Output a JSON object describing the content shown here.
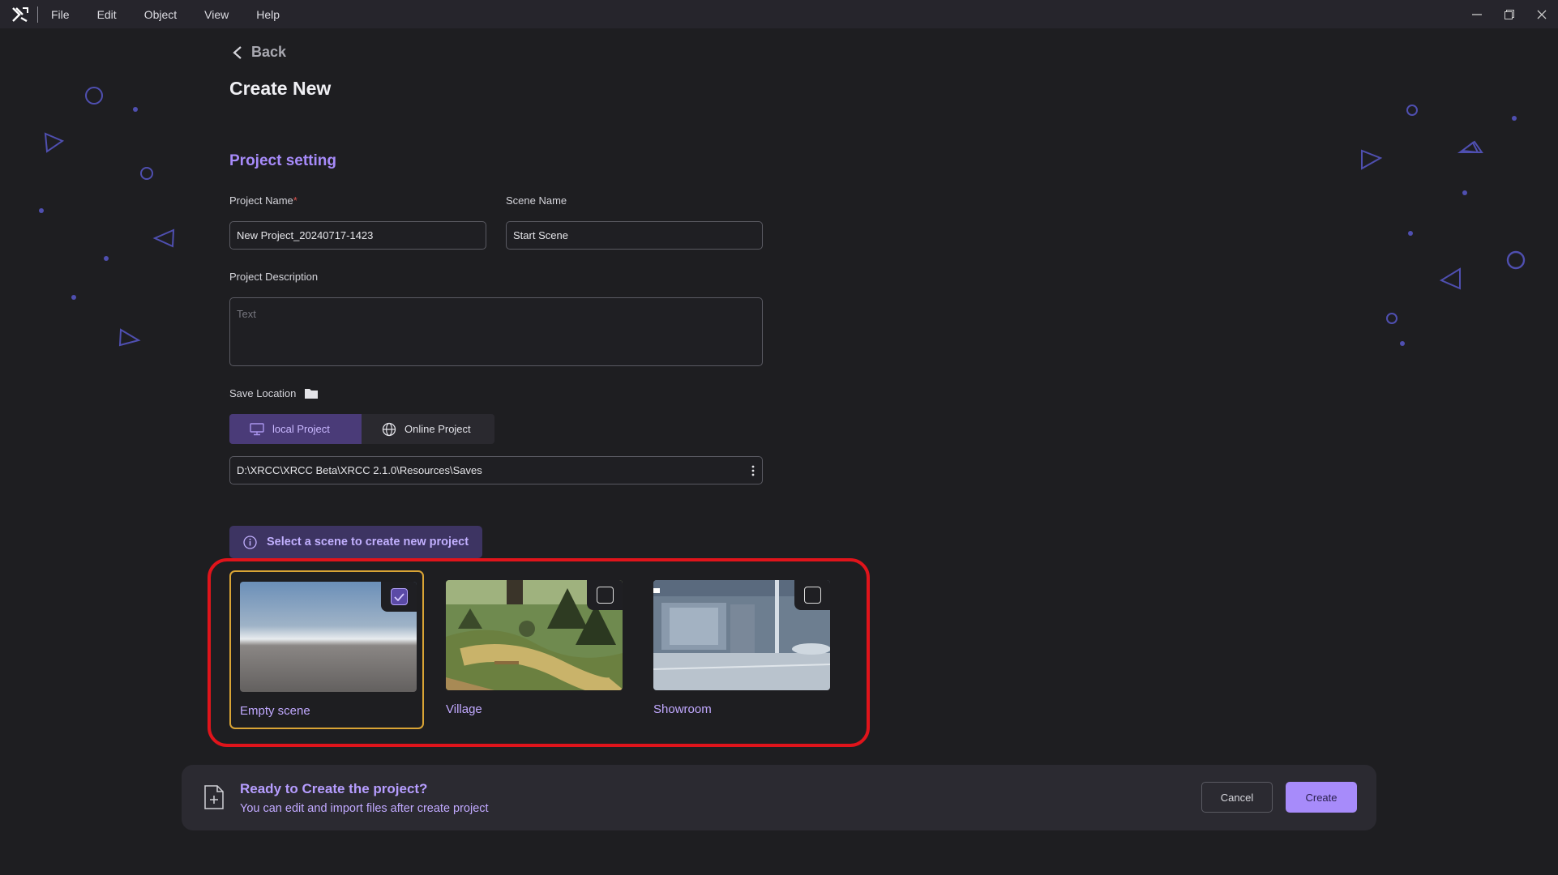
{
  "menubar": {
    "items": [
      "File",
      "Edit",
      "Object",
      "View",
      "Help"
    ]
  },
  "header": {
    "back_label": "Back",
    "title": "Create New"
  },
  "project_setting": {
    "section_title": "Project setting",
    "project_name_label": "Project Name",
    "required_mark": "*",
    "project_name_value": "New Project_20240717-1423",
    "scene_name_label": "Scene Name",
    "scene_name_value": "Start Scene",
    "description_label": "Project Description",
    "description_placeholder": "Text",
    "save_location_label": "Save Location",
    "local_project_label": "local Project",
    "online_project_label": "Online Project",
    "save_path": "D:\\XRCC\\XRCC Beta\\XRCC 2.1.0\\Resources\\Saves"
  },
  "scene_select": {
    "hint": "Select a scene to create new project",
    "scenes": [
      {
        "label": "Empty scene",
        "selected": true
      },
      {
        "label": "Village",
        "selected": false
      },
      {
        "label": "Showroom",
        "selected": false
      }
    ]
  },
  "footer": {
    "title": "Ready to Create the project?",
    "subtitle": "You can edit and import files after create project",
    "cancel_label": "Cancel",
    "create_label": "Create"
  },
  "colors": {
    "accent": "#a78bfa",
    "background": "#1e1e21",
    "highlight": "#e0141b",
    "selected_border": "#d9a435"
  }
}
